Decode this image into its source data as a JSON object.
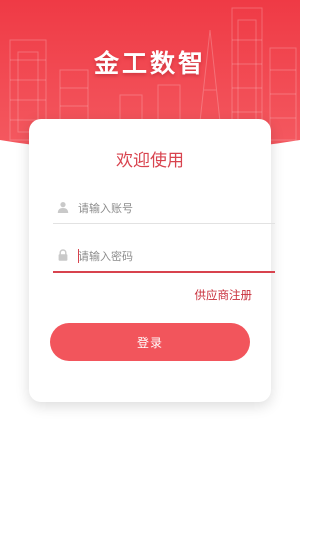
{
  "app": {
    "title": "金工数智"
  },
  "login": {
    "welcome": "欢迎使用",
    "username": {
      "placeholder": "请输入账号",
      "value": ""
    },
    "password": {
      "placeholder": "请输入密码",
      "value": ""
    },
    "supplier_register_label": "供应商注册",
    "submit_label": "登录"
  },
  "colors": {
    "brand": "#ee3f4a",
    "accent": "#d8434e",
    "button": "#f2555c"
  },
  "icons": {
    "username_field": "user-icon",
    "password_field": "lock-icon"
  }
}
